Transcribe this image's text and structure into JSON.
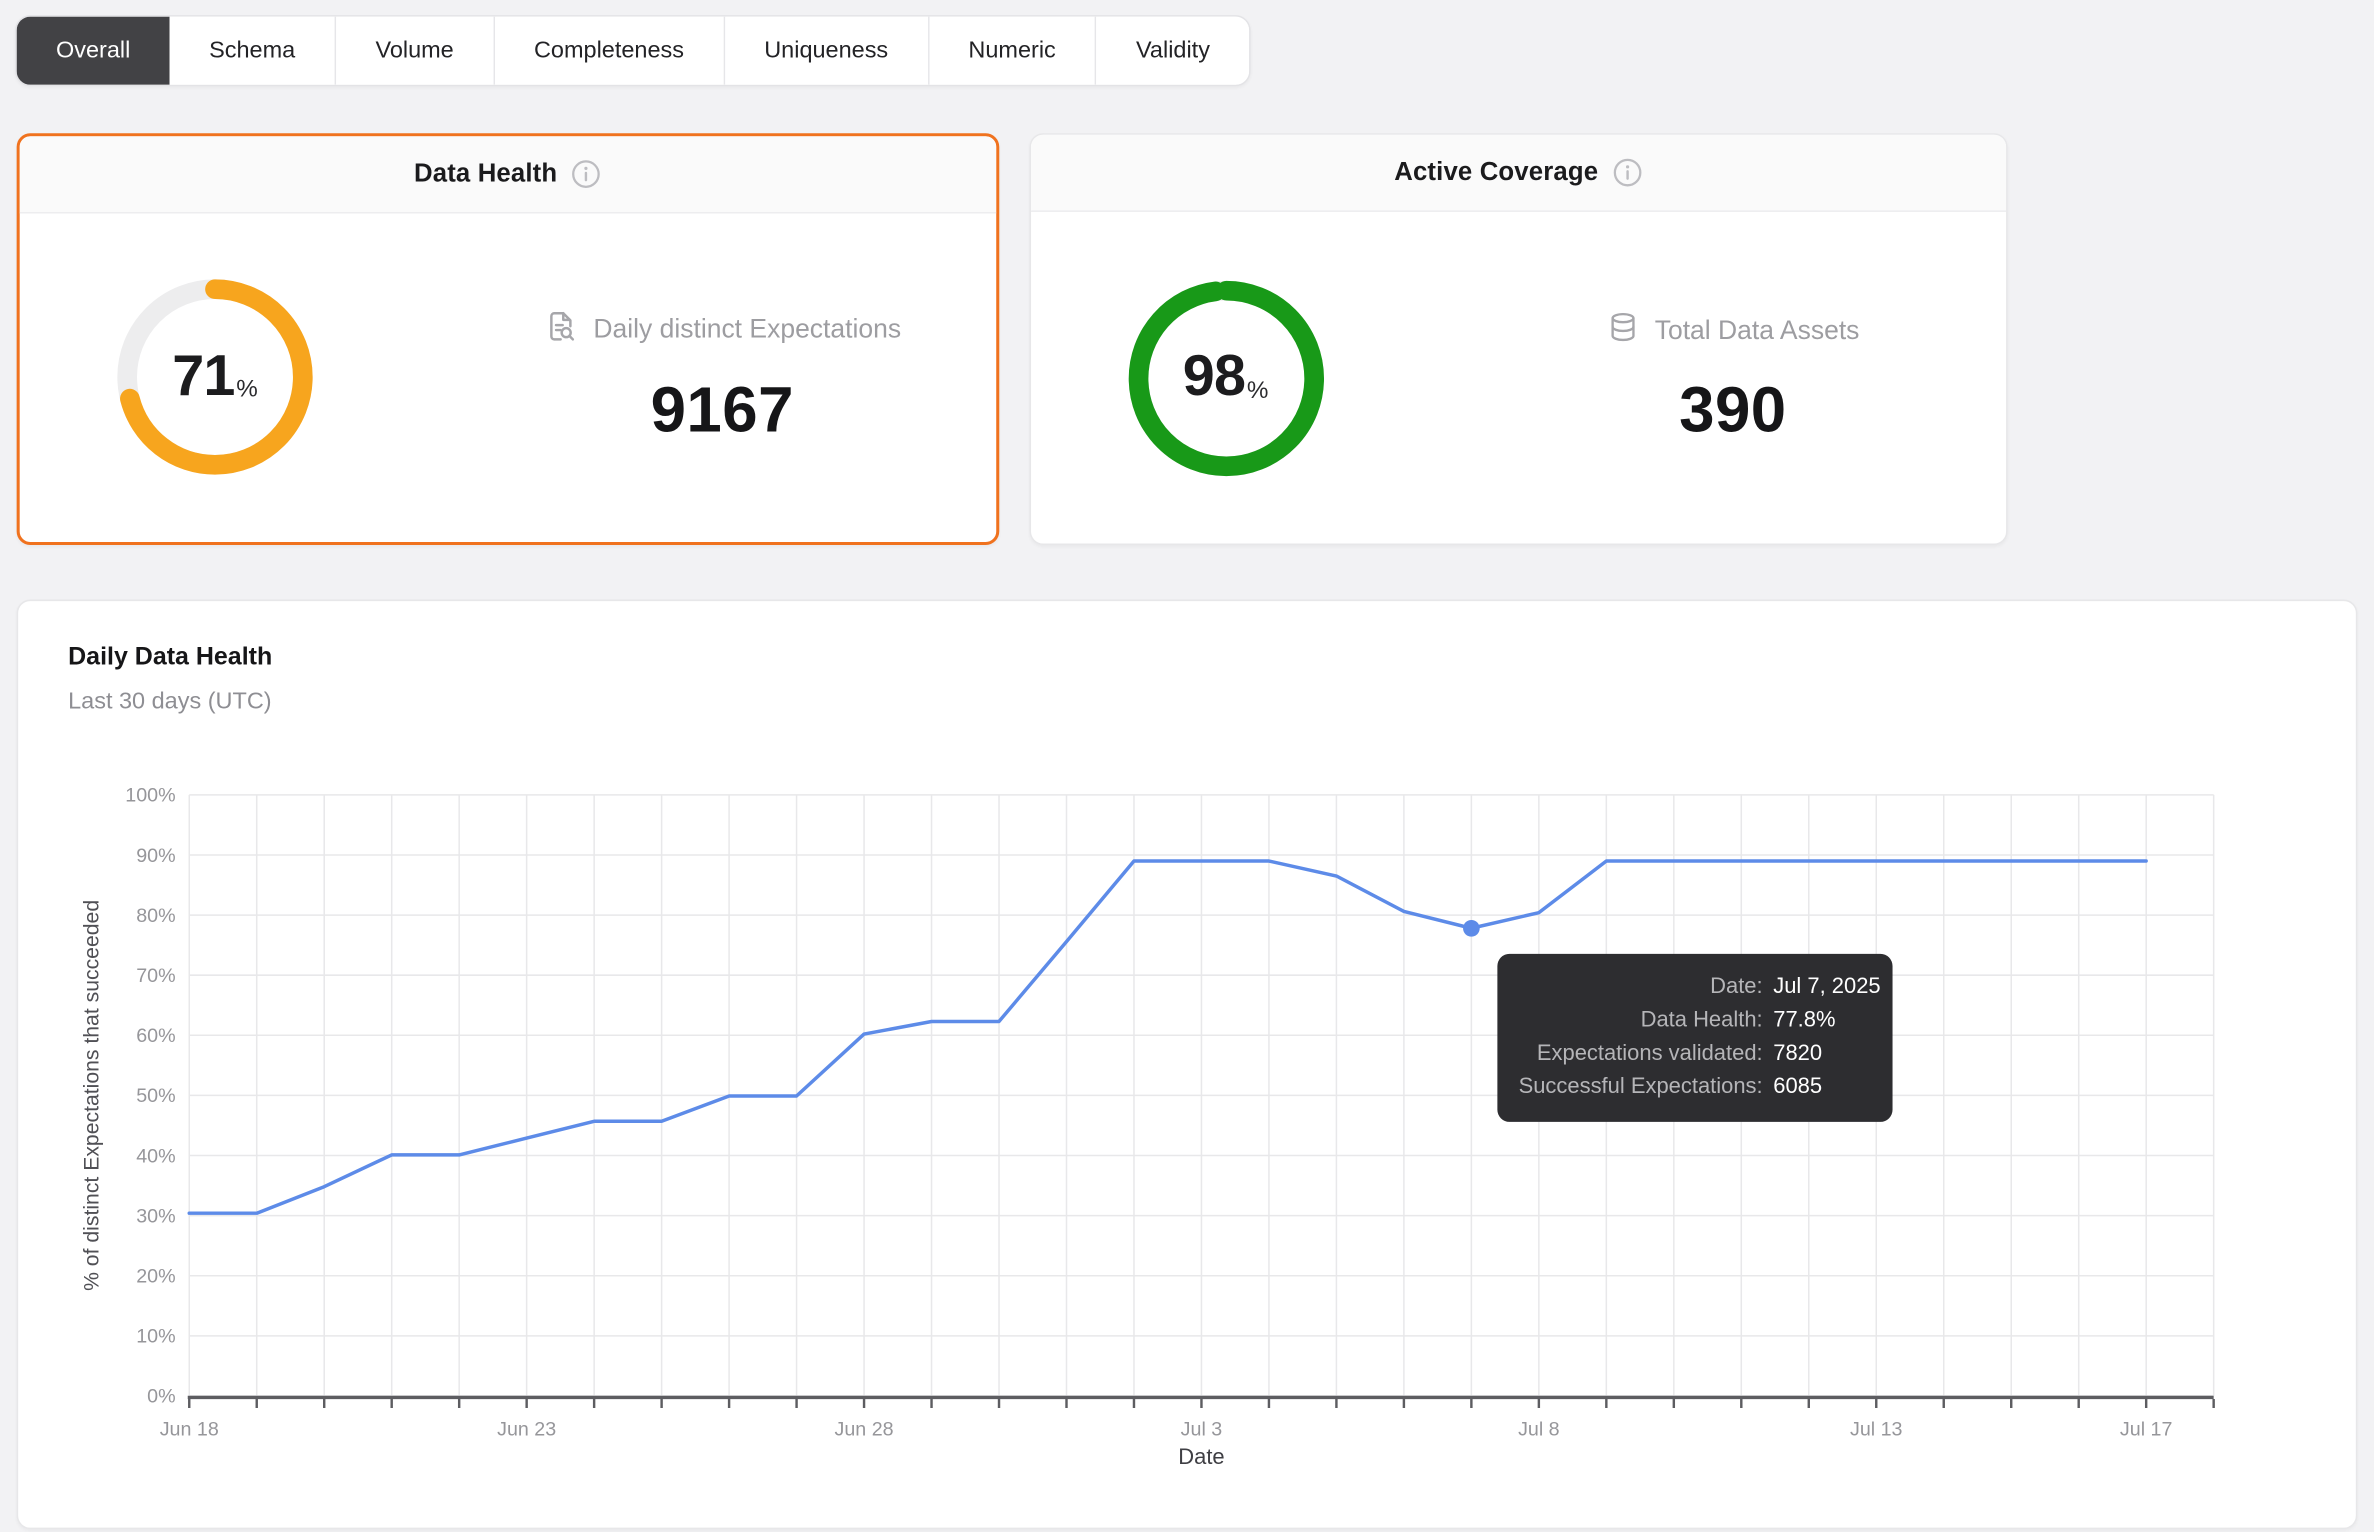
{
  "colors": {
    "selected_card_border": "#F0721E",
    "health_ring": "#F7A51E",
    "coverage_ring": "#189918",
    "line_blue": "#5D8BE8",
    "active_tab_bg": "#424245",
    "tooltip_bg": "#2d2d30"
  },
  "tabs": {
    "items": [
      {
        "label": "Overall",
        "active": true
      },
      {
        "label": "Schema",
        "active": false
      },
      {
        "label": "Volume",
        "active": false
      },
      {
        "label": "Completeness",
        "active": false
      },
      {
        "label": "Uniqueness",
        "active": false
      },
      {
        "label": "Numeric",
        "active": false
      },
      {
        "label": "Validity",
        "active": false
      }
    ]
  },
  "cards": {
    "data_health": {
      "title": "Data Health",
      "info_icon": "info-icon",
      "percent": 71,
      "percent_suffix": "%",
      "ring_color": "#F7A51E",
      "metric_icon": "file-search-icon",
      "metric_label": "Daily distinct Expectations",
      "metric_value": "9167",
      "selected": true
    },
    "active_coverage": {
      "title": "Active Coverage",
      "info_icon": "info-icon",
      "percent": 98,
      "percent_suffix": "%",
      "ring_color": "#189918",
      "metric_icon": "database-icon",
      "metric_label": "Total Data Assets",
      "metric_value": "390",
      "selected": false
    }
  },
  "chart": {
    "title": "Daily Data Health",
    "subtitle": "Last 30 days (UTC)"
  },
  "chart_data": {
    "type": "line",
    "title": "Daily Data Health",
    "subtitle": "Last 30 days (UTC)",
    "xlabel": "Date",
    "ylabel": "% of distinct Expectations that succeeded",
    "x": [
      "Jun 18",
      "Jun 19",
      "Jun 20",
      "Jun 21",
      "Jun 22",
      "Jun 23",
      "Jun 24",
      "Jun 25",
      "Jun 26",
      "Jun 27",
      "Jun 28",
      "Jun 29",
      "Jun 30",
      "Jul 1",
      "Jul 2",
      "Jul 3",
      "Jul 4",
      "Jul 5",
      "Jul 6",
      "Jul 7",
      "Jul 8",
      "Jul 9",
      "Jul 10",
      "Jul 11",
      "Jul 12",
      "Jul 13",
      "Jul 14",
      "Jul 15",
      "Jul 16",
      "Jul 17"
    ],
    "values": [
      30.4,
      30.4,
      34.8,
      40.1,
      40.1,
      42.9,
      45.7,
      45.7,
      49.9,
      49.9,
      60.2,
      62.3,
      62.3,
      75.6,
      89,
      89,
      89,
      86.5,
      80.6,
      77.8,
      80.4,
      89,
      89,
      89,
      89,
      89,
      89,
      89,
      89,
      89
    ],
    "ylim": [
      0,
      100
    ],
    "ytick_step": 10,
    "ytick_suffix": "%",
    "x_ticks": [
      {
        "index": 0,
        "label": "Jun 18"
      },
      {
        "index": 5,
        "label": "Jun 23"
      },
      {
        "index": 10,
        "label": "Jun 28"
      },
      {
        "index": 15,
        "label": "Jul 3"
      },
      {
        "index": 20,
        "label": "Jul 8"
      },
      {
        "index": 25,
        "label": "Jul 13"
      },
      {
        "index": 29,
        "label": "Jul 17"
      }
    ],
    "grid": true,
    "legend": "none",
    "line_color": "#5D8BE8",
    "highlight": {
      "index": 19,
      "value": 77.8,
      "label": "Jul 7, 2025"
    }
  },
  "tooltip": {
    "rows": [
      {
        "label": "Date:",
        "value": "Jul 7, 2025"
      },
      {
        "label": "Data Health:",
        "value": "77.8%"
      },
      {
        "label": "Expectations validated:",
        "value": "7820"
      },
      {
        "label": "Successful Expectations:",
        "value": "6085"
      }
    ]
  }
}
